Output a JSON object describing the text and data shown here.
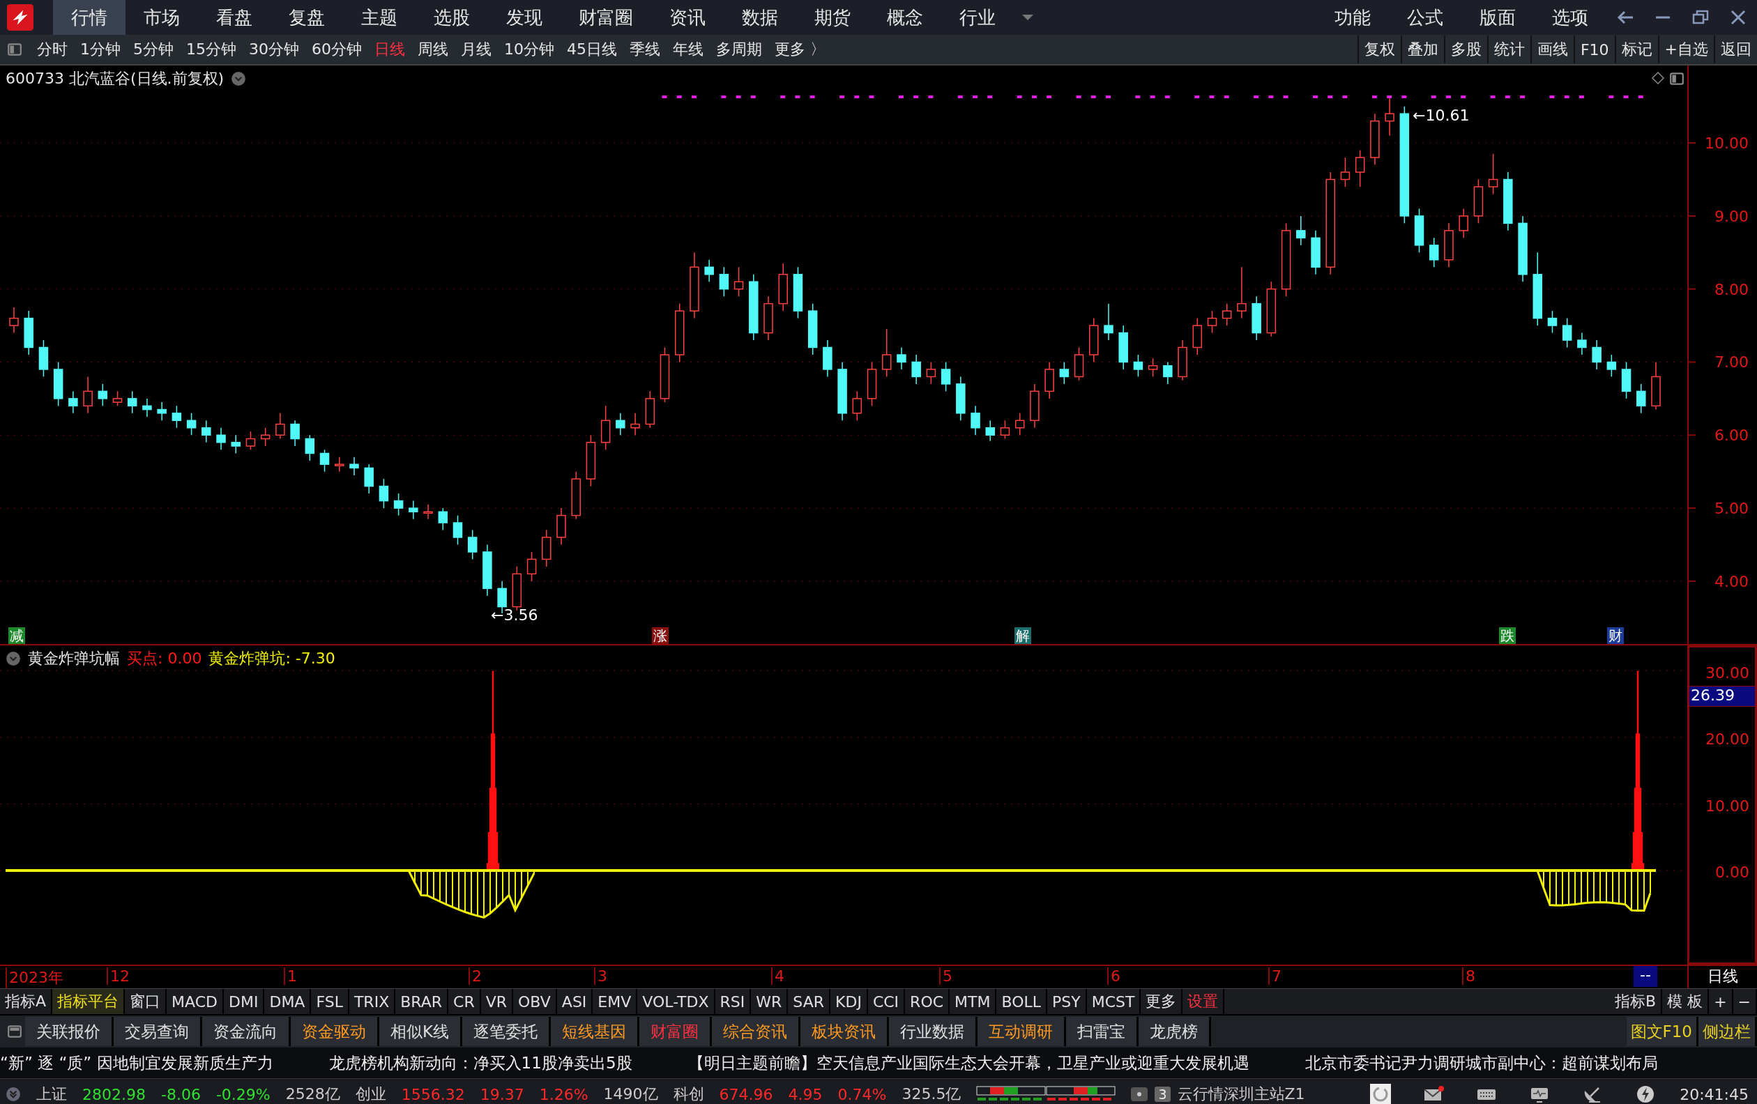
{
  "menu": {
    "items": [
      {
        "label": "行情",
        "selected": true
      },
      {
        "label": "市场",
        "selected": false
      },
      {
        "label": "看盘",
        "selected": false
      },
      {
        "label": "复盘",
        "selected": false
      },
      {
        "label": "主题",
        "selected": false
      },
      {
        "label": "选股",
        "selected": false
      },
      {
        "label": "发现",
        "selected": false
      },
      {
        "label": "财富圈",
        "selected": false
      },
      {
        "label": "资讯",
        "selected": false
      },
      {
        "label": "数据",
        "selected": false
      },
      {
        "label": "期货",
        "selected": false
      },
      {
        "label": "概念",
        "selected": false
      },
      {
        "label": "行业",
        "selected": false
      }
    ],
    "right": [
      "功能",
      "公式",
      "版面",
      "选项"
    ]
  },
  "periods": [
    {
      "label": "分时",
      "selected": false
    },
    {
      "label": "1分钟",
      "selected": false
    },
    {
      "label": "5分钟",
      "selected": false
    },
    {
      "label": "15分钟",
      "selected": false
    },
    {
      "label": "30分钟",
      "selected": false
    },
    {
      "label": "60分钟",
      "selected": false
    },
    {
      "label": "日线",
      "selected": true
    },
    {
      "label": "周线",
      "selected": false
    },
    {
      "label": "月线",
      "selected": false
    },
    {
      "label": "10分钟",
      "selected": false
    },
    {
      "label": "45日线",
      "selected": false
    },
    {
      "label": "季线",
      "selected": false
    },
    {
      "label": "年线",
      "selected": false
    },
    {
      "label": "多周期",
      "selected": false
    },
    {
      "label": "更多 〉",
      "selected": false
    }
  ],
  "tools": [
    "复权",
    "叠加",
    "多股",
    "统计",
    "画线",
    "F10",
    "标记",
    "+自选",
    "返回"
  ],
  "chart": {
    "title": "600733 北汽蓝谷(日线.前复权)",
    "high_label": "←10.61",
    "low_label": "←3.56",
    "chart_data": {
      "type": "candlestick",
      "ylim": [
        3.14,
        11.06
      ],
      "grid": true,
      "ohlc": [
        [
          7.5,
          7.75,
          7.4,
          7.6
        ],
        [
          7.6,
          7.7,
          7.1,
          7.2
        ],
        [
          7.2,
          7.3,
          6.8,
          6.9
        ],
        [
          6.9,
          7.0,
          6.4,
          6.5
        ],
        [
          6.5,
          6.6,
          6.3,
          6.4
        ],
        [
          6.4,
          6.8,
          6.3,
          6.6
        ],
        [
          6.6,
          6.7,
          6.4,
          6.5
        ],
        [
          6.45,
          6.6,
          6.4,
          6.5
        ],
        [
          6.5,
          6.6,
          6.3,
          6.4
        ],
        [
          6.4,
          6.5,
          6.25,
          6.35
        ],
        [
          6.35,
          6.45,
          6.2,
          6.3
        ],
        [
          6.3,
          6.4,
          6.1,
          6.2
        ],
        [
          6.2,
          6.3,
          6.0,
          6.1
        ],
        [
          6.1,
          6.2,
          5.9,
          6.0
        ],
        [
          6.0,
          6.1,
          5.8,
          5.9
        ],
        [
          5.9,
          6.0,
          5.75,
          5.85
        ],
        [
          5.85,
          6.05,
          5.8,
          5.95
        ],
        [
          5.95,
          6.1,
          5.85,
          6.0
        ],
        [
          6.0,
          6.3,
          5.95,
          6.15
        ],
        [
          6.15,
          6.2,
          5.85,
          5.95
        ],
        [
          5.95,
          6.0,
          5.65,
          5.75
        ],
        [
          5.75,
          5.8,
          5.5,
          5.6
        ],
        [
          5.6,
          5.7,
          5.5,
          5.6
        ],
        [
          5.6,
          5.7,
          5.45,
          5.55
        ],
        [
          5.55,
          5.6,
          5.2,
          5.3
        ],
        [
          5.3,
          5.4,
          5.0,
          5.1
        ],
        [
          5.1,
          5.2,
          4.9,
          5.0
        ],
        [
          5.0,
          5.1,
          4.85,
          4.95
        ],
        [
          4.95,
          5.05,
          4.85,
          4.95
        ],
        [
          4.95,
          5.0,
          4.7,
          4.8
        ],
        [
          4.8,
          4.9,
          4.5,
          4.6
        ],
        [
          4.6,
          4.7,
          4.3,
          4.4
        ],
        [
          4.4,
          4.5,
          3.8,
          3.9
        ],
        [
          3.9,
          4.0,
          3.56,
          3.65
        ],
        [
          3.65,
          4.2,
          3.6,
          4.1
        ],
        [
          4.1,
          4.4,
          4.0,
          4.3
        ],
        [
          4.3,
          4.7,
          4.2,
          4.6
        ],
        [
          4.6,
          5.0,
          4.5,
          4.9
        ],
        [
          4.9,
          5.5,
          4.85,
          5.4
        ],
        [
          5.4,
          6.0,
          5.3,
          5.9
        ],
        [
          5.9,
          6.4,
          5.8,
          6.2
        ],
        [
          6.2,
          6.3,
          6.0,
          6.1
        ],
        [
          6.1,
          6.3,
          6.0,
          6.15
        ],
        [
          6.15,
          6.6,
          6.1,
          6.5
        ],
        [
          6.5,
          7.2,
          6.45,
          7.1
        ],
        [
          7.1,
          7.8,
          7.0,
          7.7
        ],
        [
          7.7,
          8.5,
          7.6,
          8.3
        ],
        [
          8.3,
          8.4,
          8.1,
          8.2
        ],
        [
          8.2,
          8.3,
          7.9,
          8.0
        ],
        [
          8.0,
          8.3,
          7.9,
          8.1
        ],
        [
          8.1,
          8.2,
          7.3,
          7.4
        ],
        [
          7.4,
          7.9,
          7.3,
          7.8
        ],
        [
          7.8,
          8.35,
          7.7,
          8.2
        ],
        [
          8.2,
          8.3,
          7.6,
          7.7
        ],
        [
          7.7,
          7.8,
          7.1,
          7.2
        ],
        [
          7.2,
          7.3,
          6.8,
          6.9
        ],
        [
          6.9,
          7.0,
          6.2,
          6.3
        ],
        [
          6.3,
          6.6,
          6.2,
          6.5
        ],
        [
          6.5,
          7.0,
          6.4,
          6.9
        ],
        [
          6.9,
          7.45,
          6.8,
          7.1
        ],
        [
          7.1,
          7.2,
          6.9,
          7.0
        ],
        [
          7.0,
          7.1,
          6.7,
          6.8
        ],
        [
          6.8,
          7.0,
          6.7,
          6.9
        ],
        [
          6.9,
          7.0,
          6.6,
          6.7
        ],
        [
          6.7,
          6.8,
          6.2,
          6.3
        ],
        [
          6.3,
          6.4,
          6.0,
          6.1
        ],
        [
          6.1,
          6.2,
          5.92,
          6.0
        ],
        [
          6.0,
          6.2,
          5.95,
          6.1
        ],
        [
          6.1,
          6.3,
          6.0,
          6.2
        ],
        [
          6.2,
          6.7,
          6.1,
          6.6
        ],
        [
          6.6,
          7.0,
          6.5,
          6.9
        ],
        [
          6.9,
          7.0,
          6.7,
          6.8
        ],
        [
          6.8,
          7.2,
          6.75,
          7.1
        ],
        [
          7.1,
          7.6,
          7.0,
          7.5
        ],
        [
          7.5,
          7.8,
          7.3,
          7.4
        ],
        [
          7.4,
          7.5,
          6.9,
          7.0
        ],
        [
          7.0,
          7.1,
          6.8,
          6.9
        ],
        [
          6.9,
          7.05,
          6.8,
          6.95
        ],
        [
          6.95,
          7.0,
          6.7,
          6.8
        ],
        [
          6.8,
          7.3,
          6.75,
          7.2
        ],
        [
          7.2,
          7.6,
          7.1,
          7.5
        ],
        [
          7.5,
          7.7,
          7.4,
          7.6
        ],
        [
          7.6,
          7.8,
          7.5,
          7.7
        ],
        [
          7.7,
          8.3,
          7.6,
          7.8
        ],
        [
          7.8,
          7.9,
          7.3,
          7.4
        ],
        [
          7.4,
          8.1,
          7.35,
          8.0
        ],
        [
          8.0,
          8.9,
          7.9,
          8.8
        ],
        [
          8.8,
          9.0,
          8.6,
          8.7
        ],
        [
          8.7,
          8.8,
          8.2,
          8.3
        ],
        [
          8.3,
          9.6,
          8.2,
          9.5
        ],
        [
          9.5,
          9.8,
          9.4,
          9.6
        ],
        [
          9.6,
          9.9,
          9.4,
          9.8
        ],
        [
          9.8,
          10.4,
          9.7,
          10.3
        ],
        [
          10.3,
          10.61,
          10.1,
          10.4
        ],
        [
          10.4,
          10.5,
          8.9,
          9.0
        ],
        [
          9.0,
          9.1,
          8.5,
          8.6
        ],
        [
          8.6,
          8.7,
          8.3,
          8.4
        ],
        [
          8.4,
          8.9,
          8.3,
          8.8
        ],
        [
          8.8,
          9.1,
          8.7,
          9.0
        ],
        [
          9.0,
          9.5,
          8.9,
          9.4
        ],
        [
          9.4,
          9.85,
          9.3,
          9.5
        ],
        [
          9.5,
          9.6,
          8.8,
          8.9
        ],
        [
          8.9,
          9.0,
          8.1,
          8.2
        ],
        [
          8.2,
          8.5,
          7.5,
          7.6
        ],
        [
          7.6,
          7.7,
          7.4,
          7.5
        ],
        [
          7.5,
          7.6,
          7.2,
          7.3
        ],
        [
          7.3,
          7.4,
          7.1,
          7.2
        ],
        [
          7.2,
          7.3,
          6.9,
          7.0
        ],
        [
          7.0,
          7.1,
          6.8,
          6.9
        ],
        [
          6.9,
          7.0,
          6.5,
          6.6
        ],
        [
          6.6,
          6.7,
          6.3,
          6.4
        ],
        [
          6.4,
          7.0,
          6.35,
          6.8
        ]
      ],
      "yticks": [
        {
          "value": 10,
          "label": "10.00"
        },
        {
          "value": 9,
          "label": "9.00"
        },
        {
          "value": 8,
          "label": "8.00"
        },
        {
          "value": 7,
          "label": "7.00"
        },
        {
          "value": 6,
          "label": "6.00"
        },
        {
          "value": 5,
          "label": "5.00"
        },
        {
          "value": 4,
          "label": "4.00"
        }
      ]
    },
    "events": [
      {
        "label": "减",
        "color": "#1c8a2a"
      },
      {
        "label": "涨",
        "color": "#8a1010"
      },
      {
        "label": "解",
        "color": "#1b6e6e"
      },
      {
        "label": "跌",
        "color": "#1c8a2a"
      },
      {
        "label": "财",
        "color": "#1c3c9c"
      }
    ]
  },
  "indicator": {
    "name": "黄金炸弹坑幅",
    "buy_point": "买点: 0.00",
    "pit": "黄金炸弹坑: -7.30",
    "ticks": [
      "30.00",
      "20.00",
      "10.00",
      "0.00"
    ],
    "current": "26.39"
  },
  "date_axis": {
    "labels": [
      "2023年",
      "12",
      "1",
      "2",
      "3",
      "4",
      "5",
      "6",
      "7",
      "8"
    ],
    "cursor": "--",
    "period": "日线"
  },
  "indicator_tabs": [
    {
      "label": "指标A",
      "selected": false,
      "emphasis": false
    },
    {
      "label": "指标平台",
      "selected": true,
      "emphasis": false
    },
    {
      "label": "窗口",
      "selected": false,
      "emphasis": false
    },
    {
      "label": "MACD",
      "selected": false,
      "emphasis": false
    },
    {
      "label": "DMI",
      "selected": false,
      "emphasis": false
    },
    {
      "label": "DMA",
      "selected": false,
      "emphasis": false
    },
    {
      "label": "FSL",
      "selected": false,
      "emphasis": false
    },
    {
      "label": "TRIX",
      "selected": false,
      "emphasis": false
    },
    {
      "label": "BRAR",
      "selected": false,
      "emphasis": false
    },
    {
      "label": "CR",
      "selected": false,
      "emphasis": false
    },
    {
      "label": "VR",
      "selected": false,
      "emphasis": false
    },
    {
      "label": "OBV",
      "selected": false,
      "emphasis": false
    },
    {
      "label": "ASI",
      "selected": false,
      "emphasis": false
    },
    {
      "label": "EMV",
      "selected": false,
      "emphasis": false
    },
    {
      "label": "VOL-TDX",
      "selected": false,
      "emphasis": false
    },
    {
      "label": "RSI",
      "selected": false,
      "emphasis": false
    },
    {
      "label": "WR",
      "selected": false,
      "emphasis": false
    },
    {
      "label": "SAR",
      "selected": false,
      "emphasis": false
    },
    {
      "label": "KDJ",
      "selected": false,
      "emphasis": false
    },
    {
      "label": "CCI",
      "selected": false,
      "emphasis": false
    },
    {
      "label": "ROC",
      "selected": false,
      "emphasis": false
    },
    {
      "label": "MTM",
      "selected": false,
      "emphasis": false
    },
    {
      "label": "BOLL",
      "selected": false,
      "emphasis": false
    },
    {
      "label": "PSY",
      "selected": false,
      "emphasis": false
    },
    {
      "label": "MCST",
      "selected": false,
      "emphasis": false
    },
    {
      "label": "更多",
      "selected": false,
      "emphasis": false
    },
    {
      "label": "设置",
      "selected": false,
      "emphasis": true
    }
  ],
  "indicator_tabs_right": [
    "指标B",
    "模 板",
    "+",
    "−"
  ],
  "functions": [
    {
      "label": "关联报价",
      "kind": "normal"
    },
    {
      "label": "交易查询",
      "kind": "normal"
    },
    {
      "label": "资金流向",
      "kind": "normal"
    },
    {
      "label": "资金驱动",
      "kind": "featured"
    },
    {
      "label": "相似K线",
      "kind": "normal"
    },
    {
      "label": "逐笔委托",
      "kind": "normal"
    },
    {
      "label": "短线基因",
      "kind": "featured"
    },
    {
      "label": "财富圈",
      "kind": "community"
    },
    {
      "label": "综合资讯",
      "kind": "featured"
    },
    {
      "label": "板块资讯",
      "kind": "featured"
    },
    {
      "label": "行业数据",
      "kind": "normal"
    },
    {
      "label": "互动调研",
      "kind": "featured"
    },
    {
      "label": "扫雷宝",
      "kind": "normal"
    },
    {
      "label": "龙虎榜",
      "kind": "normal"
    }
  ],
  "functions_right": [
    "图文F10",
    "侧边栏"
  ],
  "news": [
    "“新” 逐 “质”  因地制宜发展新质生产力",
    "龙虎榜机构新动向：净买入11股净卖出5股",
    "【明日主题前瞻】空天信息产业国际生态大会开幕，卫星产业或迎重大发展机遇",
    "北京市委书记尹力调研城市副中心：超前谋划布局"
  ],
  "status": {
    "indices": [
      {
        "name": "上证",
        "value": "2802.98",
        "change": "-8.06",
        "pct": "-0.29%",
        "amount": "2528亿",
        "kind": "down"
      },
      {
        "name": "创业",
        "value": "1556.32",
        "change": "19.37",
        "pct": "1.26%",
        "amount": "1490亿",
        "kind": "up"
      },
      {
        "name": "科创",
        "value": "674.96",
        "change": "4.95",
        "pct": "0.74%",
        "amount": "325.5亿",
        "kind": "up"
      }
    ],
    "badge": "3",
    "server": "云行情深圳主站Z1",
    "time": "20:41:45"
  }
}
